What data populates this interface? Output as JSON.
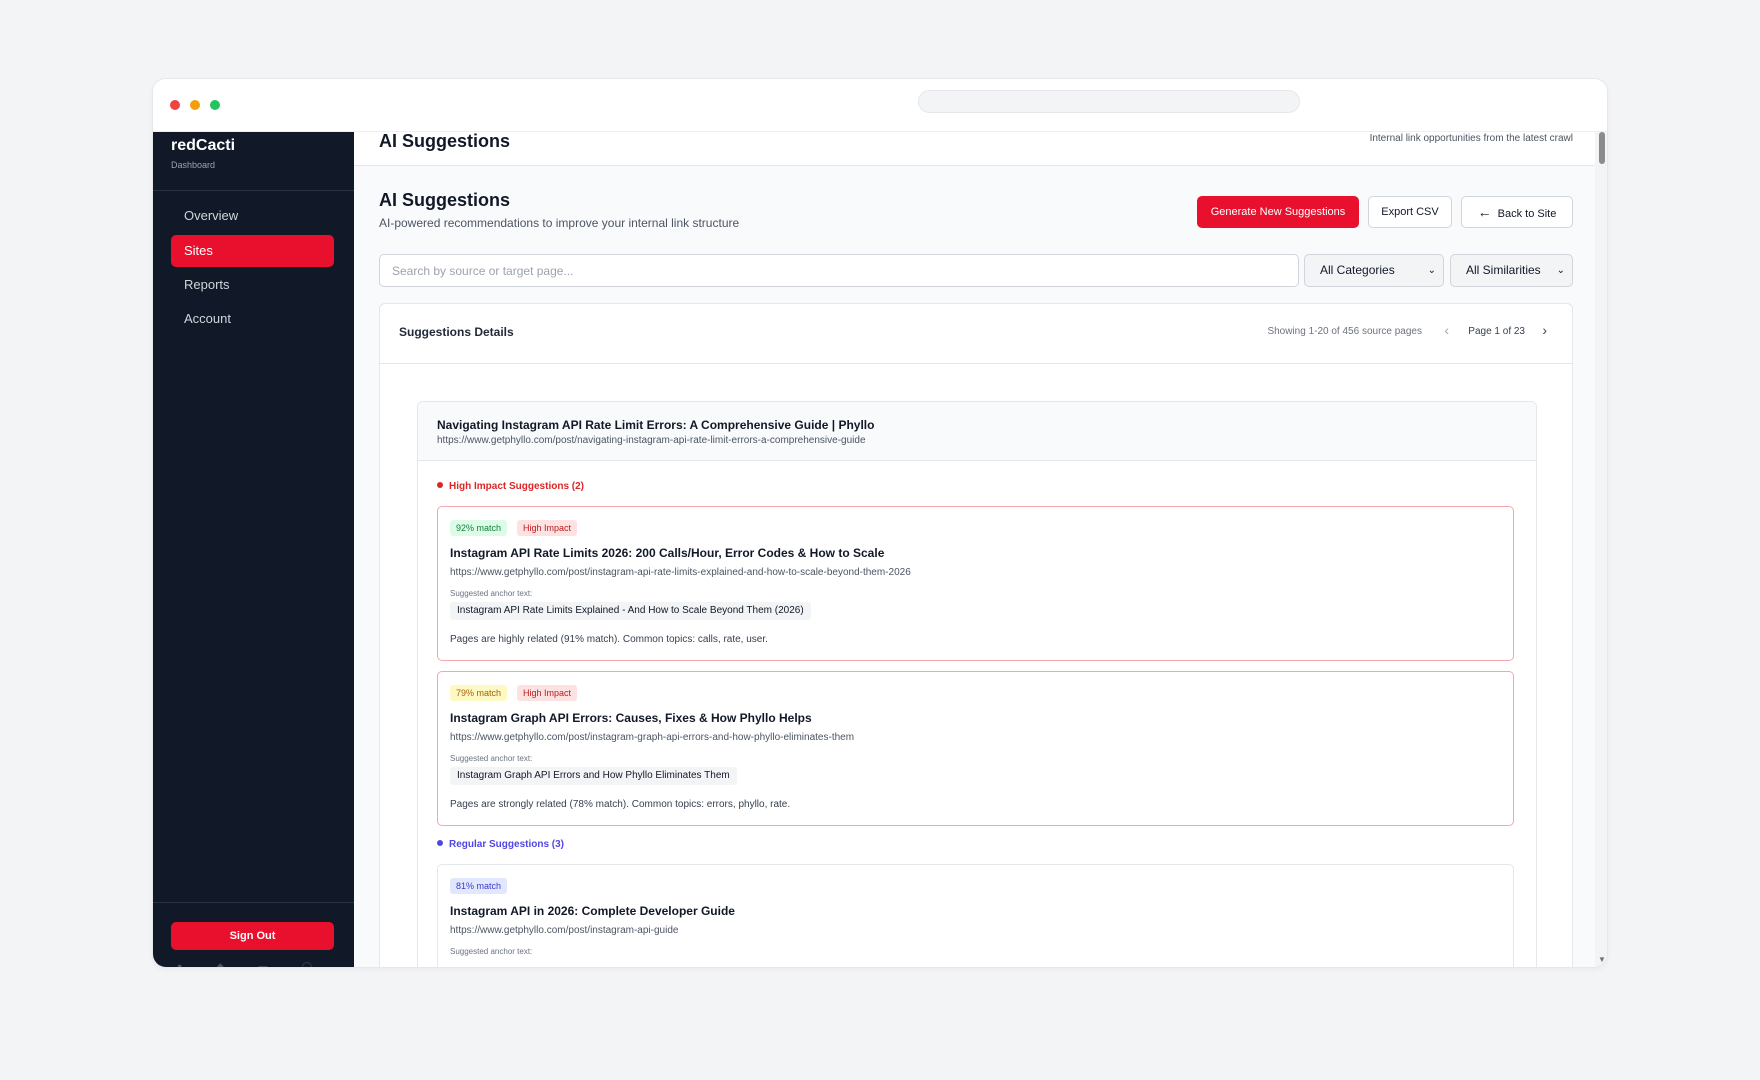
{
  "brand": {
    "name": "redCacti",
    "subtitle": "Dashboard"
  },
  "sidebar": {
    "items": [
      {
        "label": "Overview",
        "active": false
      },
      {
        "label": "Sites",
        "active": true
      },
      {
        "label": "Reports",
        "active": false
      },
      {
        "label": "Account",
        "active": false
      }
    ],
    "sign_out": "Sign Out"
  },
  "topbar": {
    "title": "AI Suggestions",
    "subtitle": "Internal link opportunities from the latest crawl"
  },
  "header": {
    "title": "AI Suggestions",
    "subtitle": "AI-powered recommendations to improve your internal link structure",
    "generate_label": "Generate New Suggestions",
    "export_label": "Export CSV",
    "back_label": "Back to Site"
  },
  "filters": {
    "search_placeholder": "Search by source or target page...",
    "category": "All Categories",
    "similarity": "All Similarities"
  },
  "panel": {
    "title": "Suggestions Details",
    "showing": "Showing 1-20 of 456 source pages",
    "page": "Page 1 of 23"
  },
  "source": {
    "title": "Navigating Instagram API Rate Limit Errors: A Comprehensive Guide | Phyllo",
    "url": "https://www.getphyllo.com/post/navigating-instagram-api-rate-limit-errors-a-comprehensive-guide"
  },
  "groups": {
    "high_label": "High Impact Suggestions (2)",
    "regular_label": "Regular Suggestions (3)"
  },
  "suggestions": [
    {
      "match": "92% match",
      "impact": "High Impact",
      "title": "Instagram API Rate Limits 2026: 200 Calls/Hour, Error Codes & How to Scale",
      "url": "https://www.getphyllo.com/post/instagram-api-rate-limits-explained-and-how-to-scale-beyond-them-2026",
      "anchor_label": "Suggested anchor text:",
      "anchor": "Instagram API Rate Limits Explained - And How to Scale Beyond Them (2026)",
      "reason": "Pages are highly related (91% match). Common topics: calls, rate, user."
    },
    {
      "match": "79% match",
      "impact": "High Impact",
      "title": "Instagram Graph API Errors: Causes, Fixes & How Phyllo Helps",
      "url": "https://www.getphyllo.com/post/instagram-graph-api-errors-and-how-phyllo-eliminates-them",
      "anchor_label": "Suggested anchor text:",
      "anchor": "Instagram Graph API Errors and How Phyllo Eliminates Them",
      "reason": "Pages are strongly related (78% match). Common topics: errors, phyllo, rate."
    },
    {
      "match": "81% match",
      "title": "Instagram API in 2026: Complete Developer Guide",
      "url": "https://www.getphyllo.com/post/instagram-api-guide",
      "anchor_label": "Suggested anchor text:"
    }
  ],
  "colors": {
    "accent": "#e8102c",
    "sidebar_bg": "#111827",
    "high": "#dc2626",
    "regular": "#4f46e5"
  }
}
